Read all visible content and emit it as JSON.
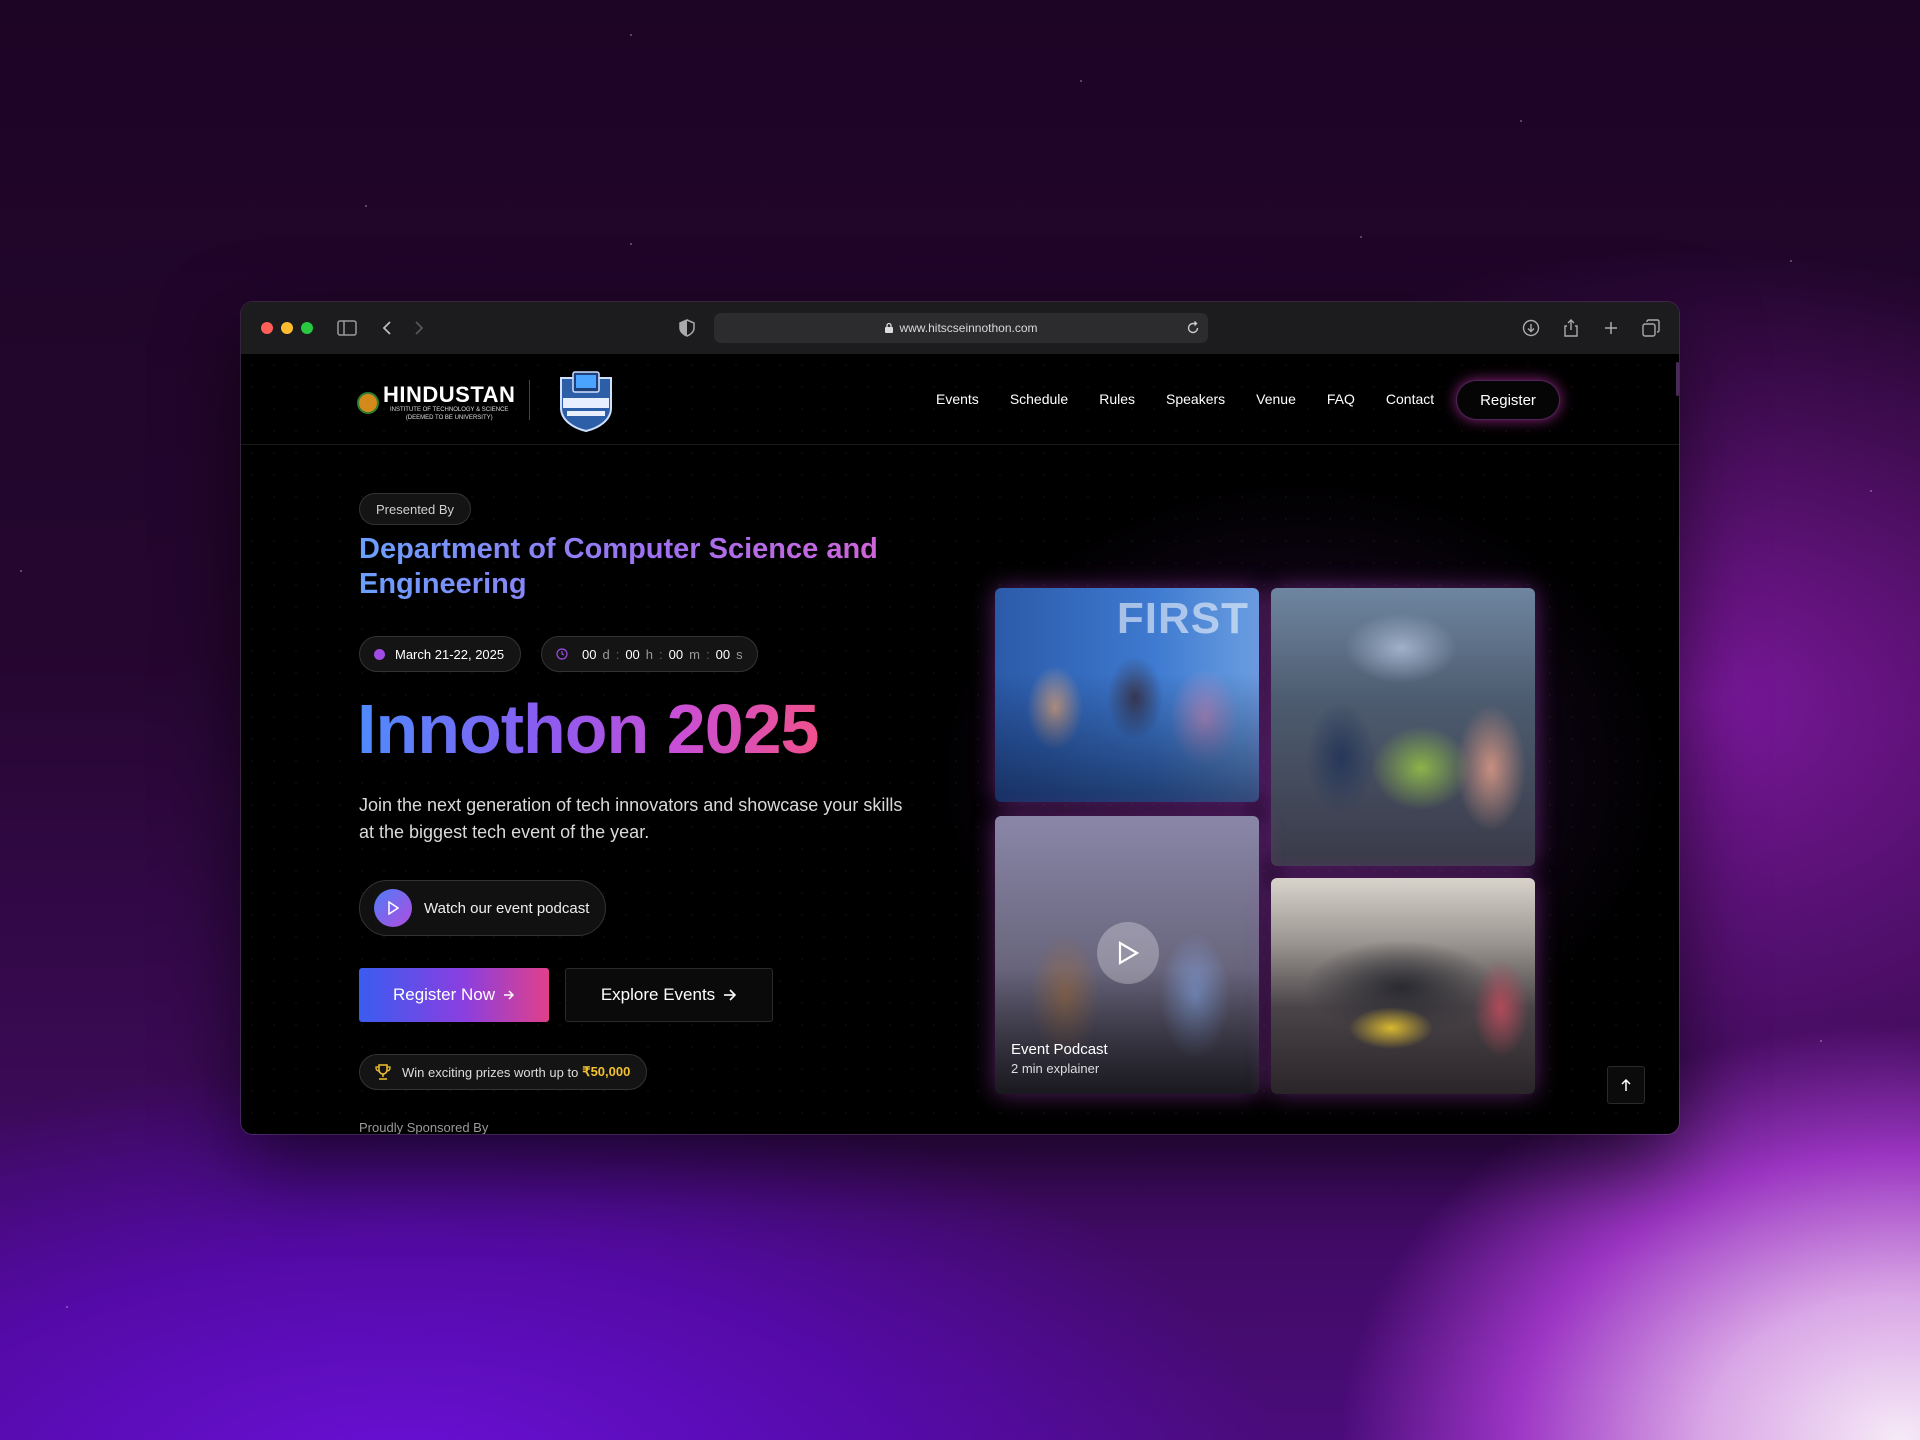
{
  "browser": {
    "url": "www.hitscseinnothon.com",
    "traffic_lights": [
      "#ff5f57",
      "#febc2e",
      "#28c840"
    ],
    "icons": [
      "sidebar-icon",
      "back-icon",
      "forward-icon",
      "shield-icon",
      "lock-icon",
      "reload-icon",
      "download-icon",
      "share-icon",
      "new-tab-icon",
      "tab-overview-icon"
    ]
  },
  "header": {
    "logo_name": "HINDUSTAN",
    "logo_sub1": "INSTITUTE OF TECHNOLOGY & SCIENCE",
    "logo_sub2": "(DEEMED TO BE UNIVERSITY)",
    "club_badge": "BLUE SCREEN PROGRAMMING CLUB",
    "nav": [
      "Events",
      "Schedule",
      "Rules",
      "Speakers",
      "Venue",
      "FAQ",
      "Contact"
    ],
    "register_label": "Register"
  },
  "hero": {
    "presented_label": "Presented By",
    "department": "Department of Computer Science and Engineering",
    "date": "March 21-22, 2025",
    "countdown": {
      "days": "00",
      "days_unit": "d",
      "hours": "00",
      "hours_unit": "h",
      "minutes": "00",
      "minutes_unit": "m",
      "seconds": "00",
      "seconds_unit": "s"
    },
    "title": "Innothon 2025",
    "description": "Join the next generation of tech innovators and showcase your skills at the biggest tech event of the year.",
    "podcast_label": "Watch our event podcast",
    "register_now": "Register Now",
    "explore_events": "Explore Events",
    "prize_text": "Win exciting prizes worth up to",
    "prize_amount": "₹50,000",
    "sponsored_label": "Proudly Sponsored By"
  },
  "gallery": {
    "photo1_text": "FIRST",
    "podcast_title": "Event Podcast",
    "podcast_sub": "2 min explainer"
  },
  "colors": {
    "accent_blue": "#3a5cf0",
    "accent_purple": "#8a3fe0",
    "accent_pink": "#e0408a",
    "prize_gold": "#f2c230"
  }
}
